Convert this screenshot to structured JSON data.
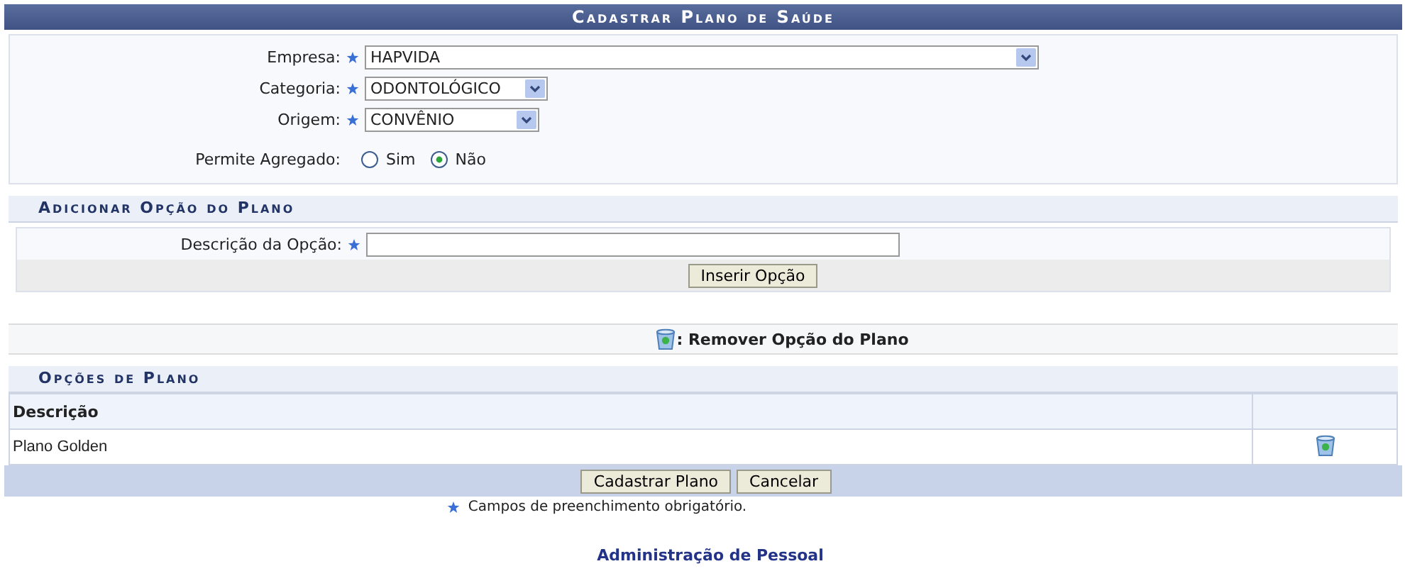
{
  "title": "Cadastrar Plano de Saúde",
  "fields": [
    {
      "label": "Empresa:",
      "value": "HAPVIDA",
      "required": true
    },
    {
      "label": "Categoria:",
      "value": "ODONTOLÓGICO",
      "required": true
    },
    {
      "label": "Origem:",
      "value": "CONVÊNIO",
      "required": true
    }
  ],
  "agregado": {
    "label": "Permite Agregado:",
    "options": [
      {
        "label": "Sim",
        "selected": false
      },
      {
        "label": "Não",
        "selected": true
      }
    ]
  },
  "add_section": {
    "title": "Adicionar Opção do Plano",
    "field_label": "Descrição da Opção:",
    "required": true,
    "button": "Inserir Opção"
  },
  "legend": ": Remover Opção do Plano",
  "options_section": {
    "title": "Opções de Plano",
    "column": "Descrição",
    "rows": [
      "Plano Golden"
    ]
  },
  "buttons": [
    "Cadastrar Plano",
    "Cancelar"
  ],
  "required_note": "Campos de preenchimento obrigatório.",
  "footer": "Administração de Pessoal"
}
